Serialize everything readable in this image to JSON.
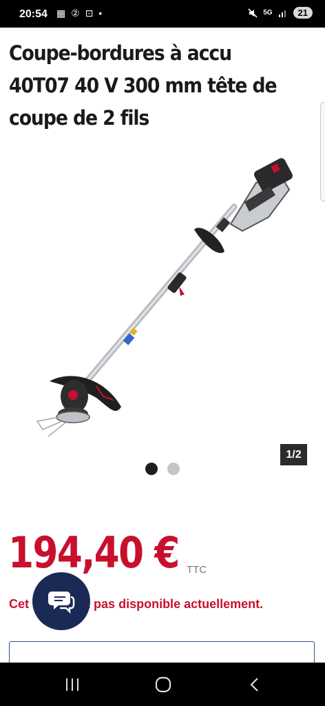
{
  "status_bar": {
    "time": "20:54",
    "left_icons": [
      "calendar-icon",
      "notification-2-icon",
      "screenshot-icon",
      "dot-icon"
    ],
    "network": "5G",
    "battery": "21"
  },
  "product": {
    "title": "Coupe-bordures à accu 40T07 40 V 300 mm tête de coupe de 2 fils"
  },
  "gallery": {
    "counter": "1/2",
    "image_icon": "string-trimmer-image",
    "active_index": 1,
    "total": 2
  },
  "pricing": {
    "price": "194,40 €",
    "suffix": "TTC",
    "availability": "Cet article est pas disponible actuellement.",
    "accent_color": "#c8102e"
  },
  "chat": {
    "icon": "chat-bubbles-icon",
    "color": "#1b2a55"
  },
  "nav": {
    "icons": [
      "recent-apps-icon",
      "home-icon",
      "back-icon"
    ]
  }
}
